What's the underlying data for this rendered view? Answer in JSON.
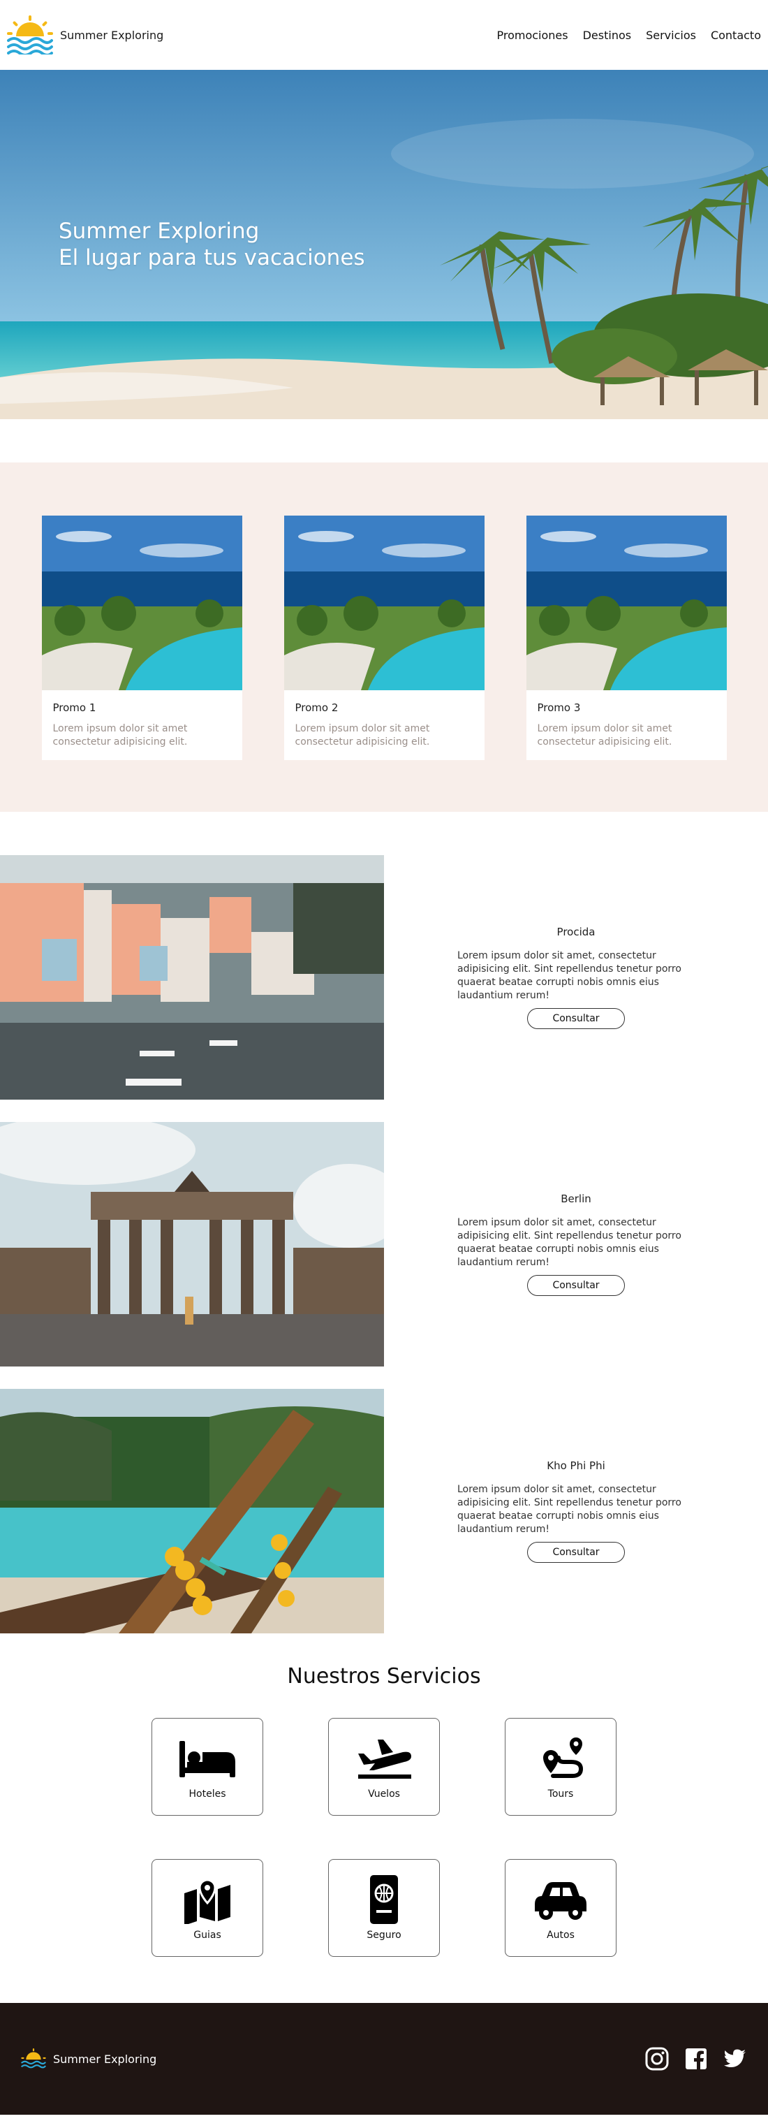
{
  "brand": {
    "name": "Summer Exploring"
  },
  "nav": [
    {
      "label": "Promociones"
    },
    {
      "label": "Destinos"
    },
    {
      "label": "Servicios"
    },
    {
      "label": "Contacto"
    }
  ],
  "hero": {
    "line1": "Summer Exploring",
    "line2": "El lugar para tus vacaciones"
  },
  "promos": [
    {
      "title": "Promo 1",
      "text": "Lorem ipsum dolor sit amet consectetur adipisicing elit."
    },
    {
      "title": "Promo 2",
      "text": "Lorem ipsum dolor sit amet consectetur adipisicing elit."
    },
    {
      "title": "Promo 3",
      "text": "Lorem ipsum dolor sit amet consectetur adipisicing elit."
    }
  ],
  "destinations": [
    {
      "title": "Procida",
      "text": "Lorem ipsum dolor sit amet, consectetur adipisicing elit. Sint repellendus tenetur porro quaerat beatae corrupti nobis omnis eius laudantium rerum!",
      "button": "Consultar"
    },
    {
      "title": "Berlin",
      "text": "Lorem ipsum dolor sit amet, consectetur adipisicing elit. Sint repellendus tenetur porro quaerat beatae corrupti nobis omnis eius laudantium rerum!",
      "button": "Consultar"
    },
    {
      "title": "Kho Phi Phi",
      "text": "Lorem ipsum dolor sit amet, consectetur adipisicing elit. Sint repellendus tenetur porro quaerat beatae corrupti nobis omnis eius laudantium rerum!",
      "button": "Consultar"
    }
  ],
  "services": {
    "title": "Nuestros Servicios",
    "items": [
      {
        "label": "Hoteles",
        "icon": "bed-icon"
      },
      {
        "label": "Vuelos",
        "icon": "plane-icon"
      },
      {
        "label": "Tours",
        "icon": "route-icon"
      },
      {
        "label": "Guias",
        "icon": "map-icon"
      },
      {
        "label": "Seguro",
        "icon": "passport-icon"
      },
      {
        "label": "Autos",
        "icon": "car-icon"
      }
    ]
  },
  "footer": {
    "name": "Summer Exploring"
  },
  "social": [
    "instagram-icon",
    "facebook-icon",
    "twitter-icon"
  ],
  "colors": {
    "promo_bg": "#f8eeea",
    "footer_bg": "#1f1513",
    "hero_sky": "#3f86ba",
    "sea": "#2fb8c7"
  }
}
